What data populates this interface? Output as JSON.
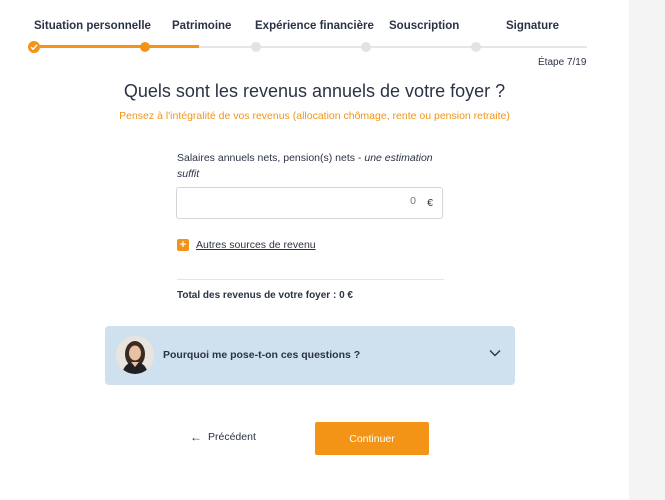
{
  "stepper": {
    "steps": [
      {
        "label": "Situation personnelle",
        "state": "done"
      },
      {
        "label": "Patrimoine",
        "state": "active"
      },
      {
        "label": "Expérience financière",
        "state": "todo"
      },
      {
        "label": "Souscription",
        "state": "todo"
      },
      {
        "label": "Signature",
        "state": "todo"
      }
    ],
    "step_counter": "Étape 7/19"
  },
  "question": {
    "title": "Quels sont les revenus annuels de votre foyer ?",
    "subtitle": "Pensez à l'intégralité de vos revenus (allocation chômage, rente ou pension retraite)"
  },
  "income_field": {
    "label": "Salaires annuels nets, pension(s) nets - ",
    "label_hint": "une estimation suffit",
    "placeholder": "0",
    "value": "",
    "currency": "€"
  },
  "add_income": {
    "label": "Autres sources de revenu"
  },
  "total": {
    "label": "Total des revenus de votre foyer : 0 €"
  },
  "faq": {
    "question": "Pourquoi me pose-t-on ces questions ?"
  },
  "navigation": {
    "prev_label": "Précédent",
    "next_label": "Continuer"
  },
  "colors": {
    "accent": "#f39417",
    "text": "#2a3346",
    "faq_bg": "#cfe1ee"
  }
}
